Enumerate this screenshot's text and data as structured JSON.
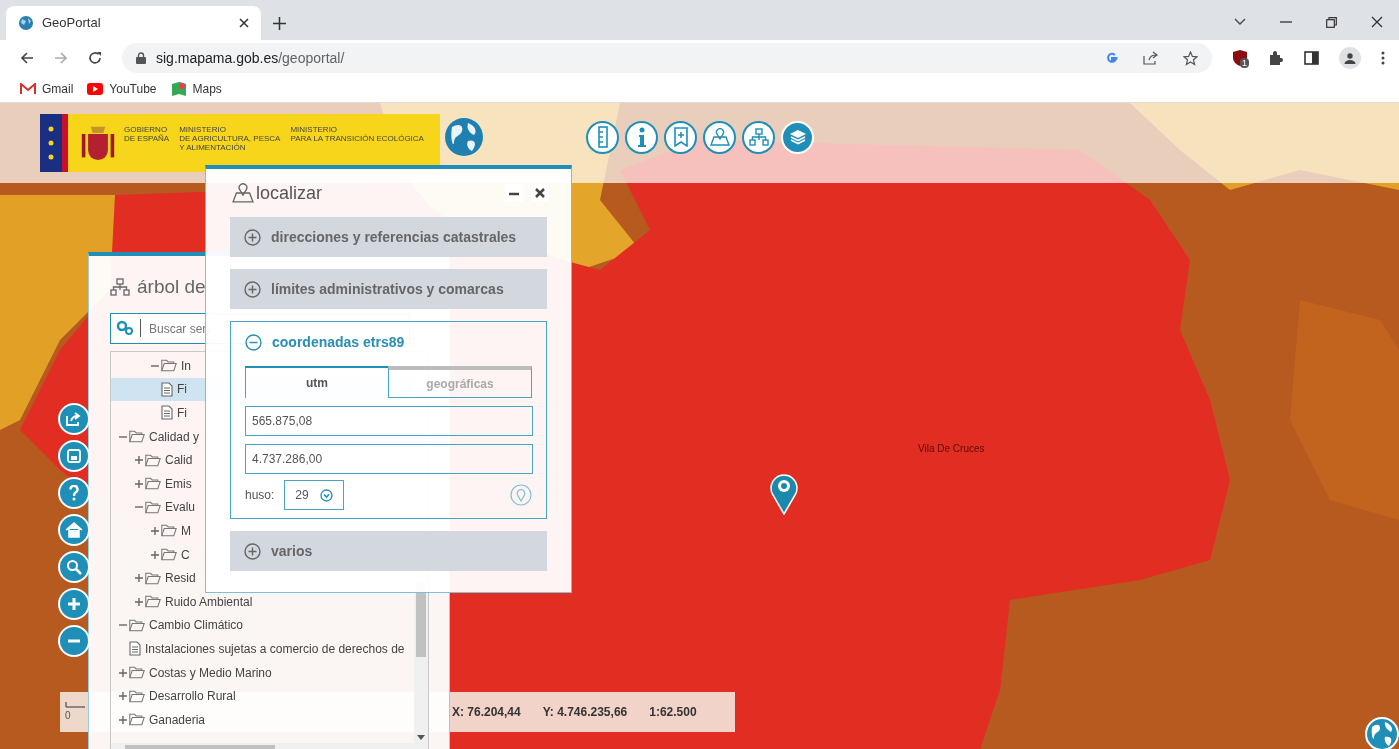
{
  "browser": {
    "tab_title": "GeoPortal",
    "url_host": "sig.mapama.gob.es",
    "url_path": "/geoportal/",
    "bookmarks": [
      {
        "label": "Gmail",
        "kind": "gmail"
      },
      {
        "label": "YouTube",
        "kind": "youtube"
      },
      {
        "label": "Maps",
        "kind": "maps"
      }
    ],
    "extension_badge": "1"
  },
  "header": {
    "logo_blocks": [
      [
        "GOBIERNO",
        "DE ESPAÑA"
      ],
      [
        "MINISTERIO",
        "DE AGRICULTURA, PESCA",
        "Y ALIMENTACIÓN"
      ],
      [
        "MINISTERIO",
        "PARA LA TRANSICIÓN ECOLÓGICA"
      ]
    ]
  },
  "map": {
    "place_label": "Vila De Cruces"
  },
  "tree_panel": {
    "title": "árbol de",
    "search_placeholder": "Buscar serv",
    "items": [
      {
        "children": [
          {
            "children": [
              {
                "label": "In",
                "kind": "folder",
                "expanded": true,
                "selected": false,
                "children": [
                  {
                    "label": "Fi",
                    "kind": "file",
                    "selected": true
                  },
                  {
                    "label": "Fi",
                    "kind": "file",
                    "selected": false
                  }
                ]
              }
            ]
          }
        ]
      },
      {
        "label": "Calidad y",
        "kind": "folder",
        "expanded": true,
        "selected": false,
        "children": [
          {
            "label": "Calid",
            "kind": "folder",
            "expanded": false,
            "selected": false
          },
          {
            "label": "Emis",
            "kind": "folder",
            "expanded": false,
            "selected": false
          },
          {
            "label": "Evalu",
            "kind": "folder",
            "expanded": true,
            "selected": false,
            "children": [
              {
                "label": "M",
                "kind": "folder",
                "expanded": false,
                "selected": false
              },
              {
                "label": "C",
                "kind": "folder",
                "expanded": false,
                "selected": false
              }
            ]
          },
          {
            "label": "Resid",
            "kind": "folder",
            "expanded": false,
            "selected": false
          },
          {
            "label": "Ruido Ambiental",
            "kind": "folder",
            "expanded": false,
            "selected": false
          }
        ]
      },
      {
        "label": "Cambio Climático",
        "kind": "folder",
        "expanded": true,
        "selected": false,
        "children": [
          {
            "label": "Instalaciones sujetas a comercio de derechos de",
            "kind": "file",
            "selected": false
          }
        ]
      },
      {
        "label": "Costas y Medio Marino",
        "kind": "folder",
        "expanded": false,
        "selected": false
      },
      {
        "label": "Desarrollo Rural",
        "kind": "folder",
        "expanded": false,
        "selected": false
      },
      {
        "label": "Ganaderia",
        "kind": "folder",
        "expanded": false,
        "selected": false
      }
    ]
  },
  "locate_dialog": {
    "title": "localizar",
    "sections": [
      {
        "label": "direcciones y referencias catastrales",
        "expanded": false
      },
      {
        "label": "límites administrativos y comarcas",
        "expanded": false
      },
      {
        "label": "coordenadas etrs89",
        "expanded": true,
        "tabs": [
          {
            "label": "utm",
            "selected": true
          },
          {
            "label": "geográficas",
            "selected": false
          }
        ],
        "fields": [
          "565.875,08",
          "4.737.286,00"
        ],
        "zone_label": "huso:",
        "zone_value": "29"
      },
      {
        "label": "varios",
        "expanded": false
      }
    ]
  },
  "status_bar": {
    "scale_label": "0",
    "x": "X: 76.204,44",
    "y": "Y: 4.746.235,66",
    "scale": "1:62.500"
  }
}
